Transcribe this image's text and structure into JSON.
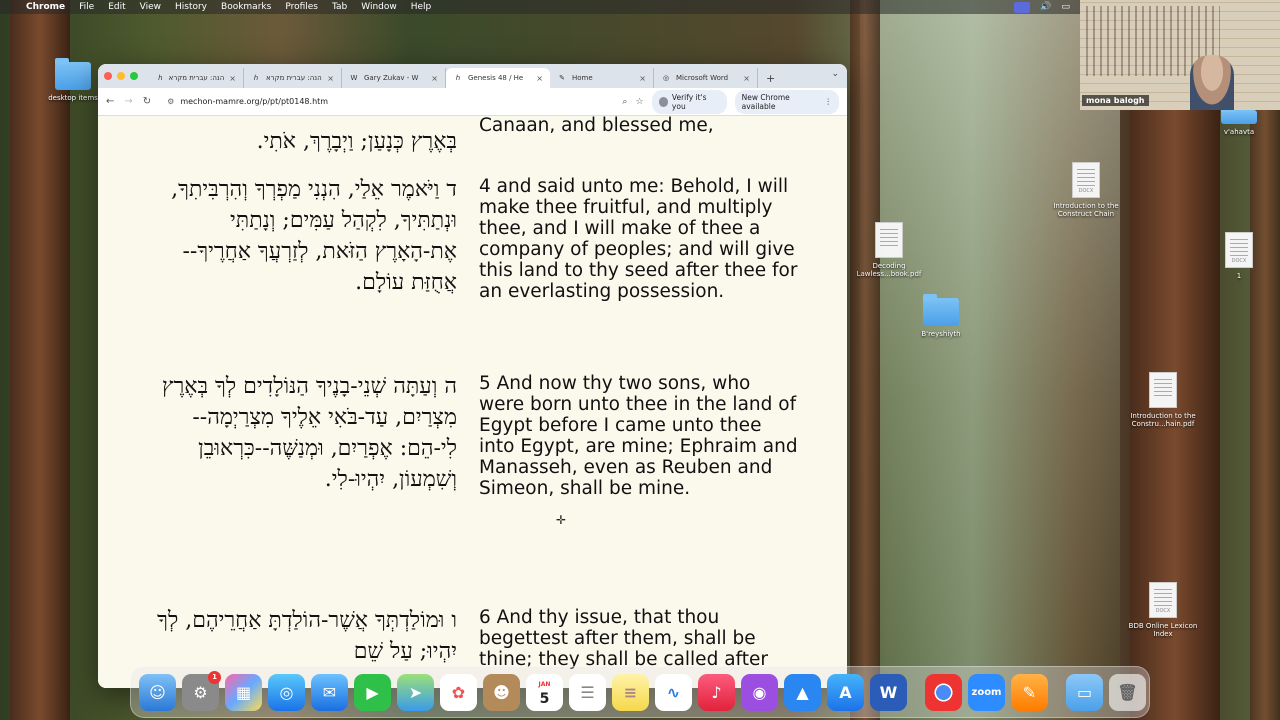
{
  "menubar": {
    "apple": "",
    "app": "Chrome",
    "items": [
      "File",
      "Edit",
      "View",
      "History",
      "Bookmarks",
      "Profiles",
      "Tab",
      "Window",
      "Help"
    ]
  },
  "desktop": {
    "desktop_items_label": "desktop items",
    "vahavta_label": "v'ahavta",
    "construct_chain_doc": "Introduction to the Construct Chain",
    "construct_chain_docx_tag": "DOCX",
    "decoding_pdf": "Decoding Lawless...book.pdf",
    "breyshiyth_folder": "B'reyshiyth",
    "file_one": "1",
    "file_one_tag": "DOCX",
    "construct_pdf": "Introduction to the Constru...hain.pdf",
    "bdb_index": "BDB Online Lexicon Index",
    "bdb_tag": "DOCX"
  },
  "browser": {
    "tabs": [
      {
        "label": "הנה: עברית מקרא",
        "fav": "ℎ"
      },
      {
        "label": "הנה: עברית מקרא",
        "fav": "ℎ"
      },
      {
        "label": "Gary Zukav - W",
        "fav": "W"
      },
      {
        "label": "Genesis 48 / He",
        "fav": "ℎ"
      },
      {
        "label": "Home",
        "fav": "✎"
      },
      {
        "label": "Microsoft Word",
        "fav": "◎"
      }
    ],
    "new_tab": "+",
    "url": "mechon-mamre.org/p/pt/pt0148.htm",
    "verify_label": "Verify it's you",
    "update_label": "New Chrome available"
  },
  "verses": {
    "v3_heb": "בְּאֶרֶץ כְּנָעַן; וַיְבָרֶךְ, אֹתִי.",
    "v3_eng": "Canaan, and blessed me,",
    "v4_heb": "ד  וַיֹּאמֶר אֵלַי, הִנְנִי מַפְרְךָ וְהִרְבִּיתִךָ, וּנְתַתִּיךָ, לִקְהַל עַמִּים; וְנָתַתִּי אֶת-הָאָרֶץ הַזֹּאת, לְזַרְעֲךָ אַחֲרֶיךָ--אֲחֻזַּת עוֹלָם.",
    "v4_eng": "4 and said unto me: Behold, I will make thee fruitful, and multiply thee, and I will make of thee a company of peoples; and will give this land to thy seed after thee for an everlasting possession.",
    "v5_heb": "ה  וְעַתָּה שְׁנֵי-בָנֶיךָ הַנּוֹלָדִים לְךָ בְּאֶרֶץ מִצְרַיִם, עַד-בֹּאִי אֵלֶיךָ מִצְרַיְמָה--לִי-הֵם:  אֶפְרַיִם, וּמְנַשֶּׁה--כִּרְאוּבֵן וְשִׁמְעוֹן, יִהְיוּ-לִי.",
    "v5_eng": "5 And now thy two sons, who were born unto thee in the land of Egypt before I came unto thee into Egypt, are mine; Ephraim and Manasseh, even as Reuben and Simeon, shall be mine.",
    "v6_heb": "ו  וּמוֹלַדְתְּךָ אֲשֶׁר-הוֹלַדְתָּ אַחֲרֵיהֶם, לְךָ יִהְיוּ; עַל שֵׁם",
    "v6_eng": "6 And thy issue, that thou begettest after them, shall be thine; they shall be called after"
  },
  "zoom": {
    "participant_name": "mona balogh"
  },
  "dock": {
    "settings_badge": "1",
    "calendar_month": "JAN",
    "calendar_day": "5",
    "zoom_label": "zoom",
    "word_label": "W"
  },
  "colors": {
    "chrome_tab_bg": "#dde3ea",
    "page_bg": "#fbf8ec",
    "folder_blue": "#4aa0e8"
  }
}
